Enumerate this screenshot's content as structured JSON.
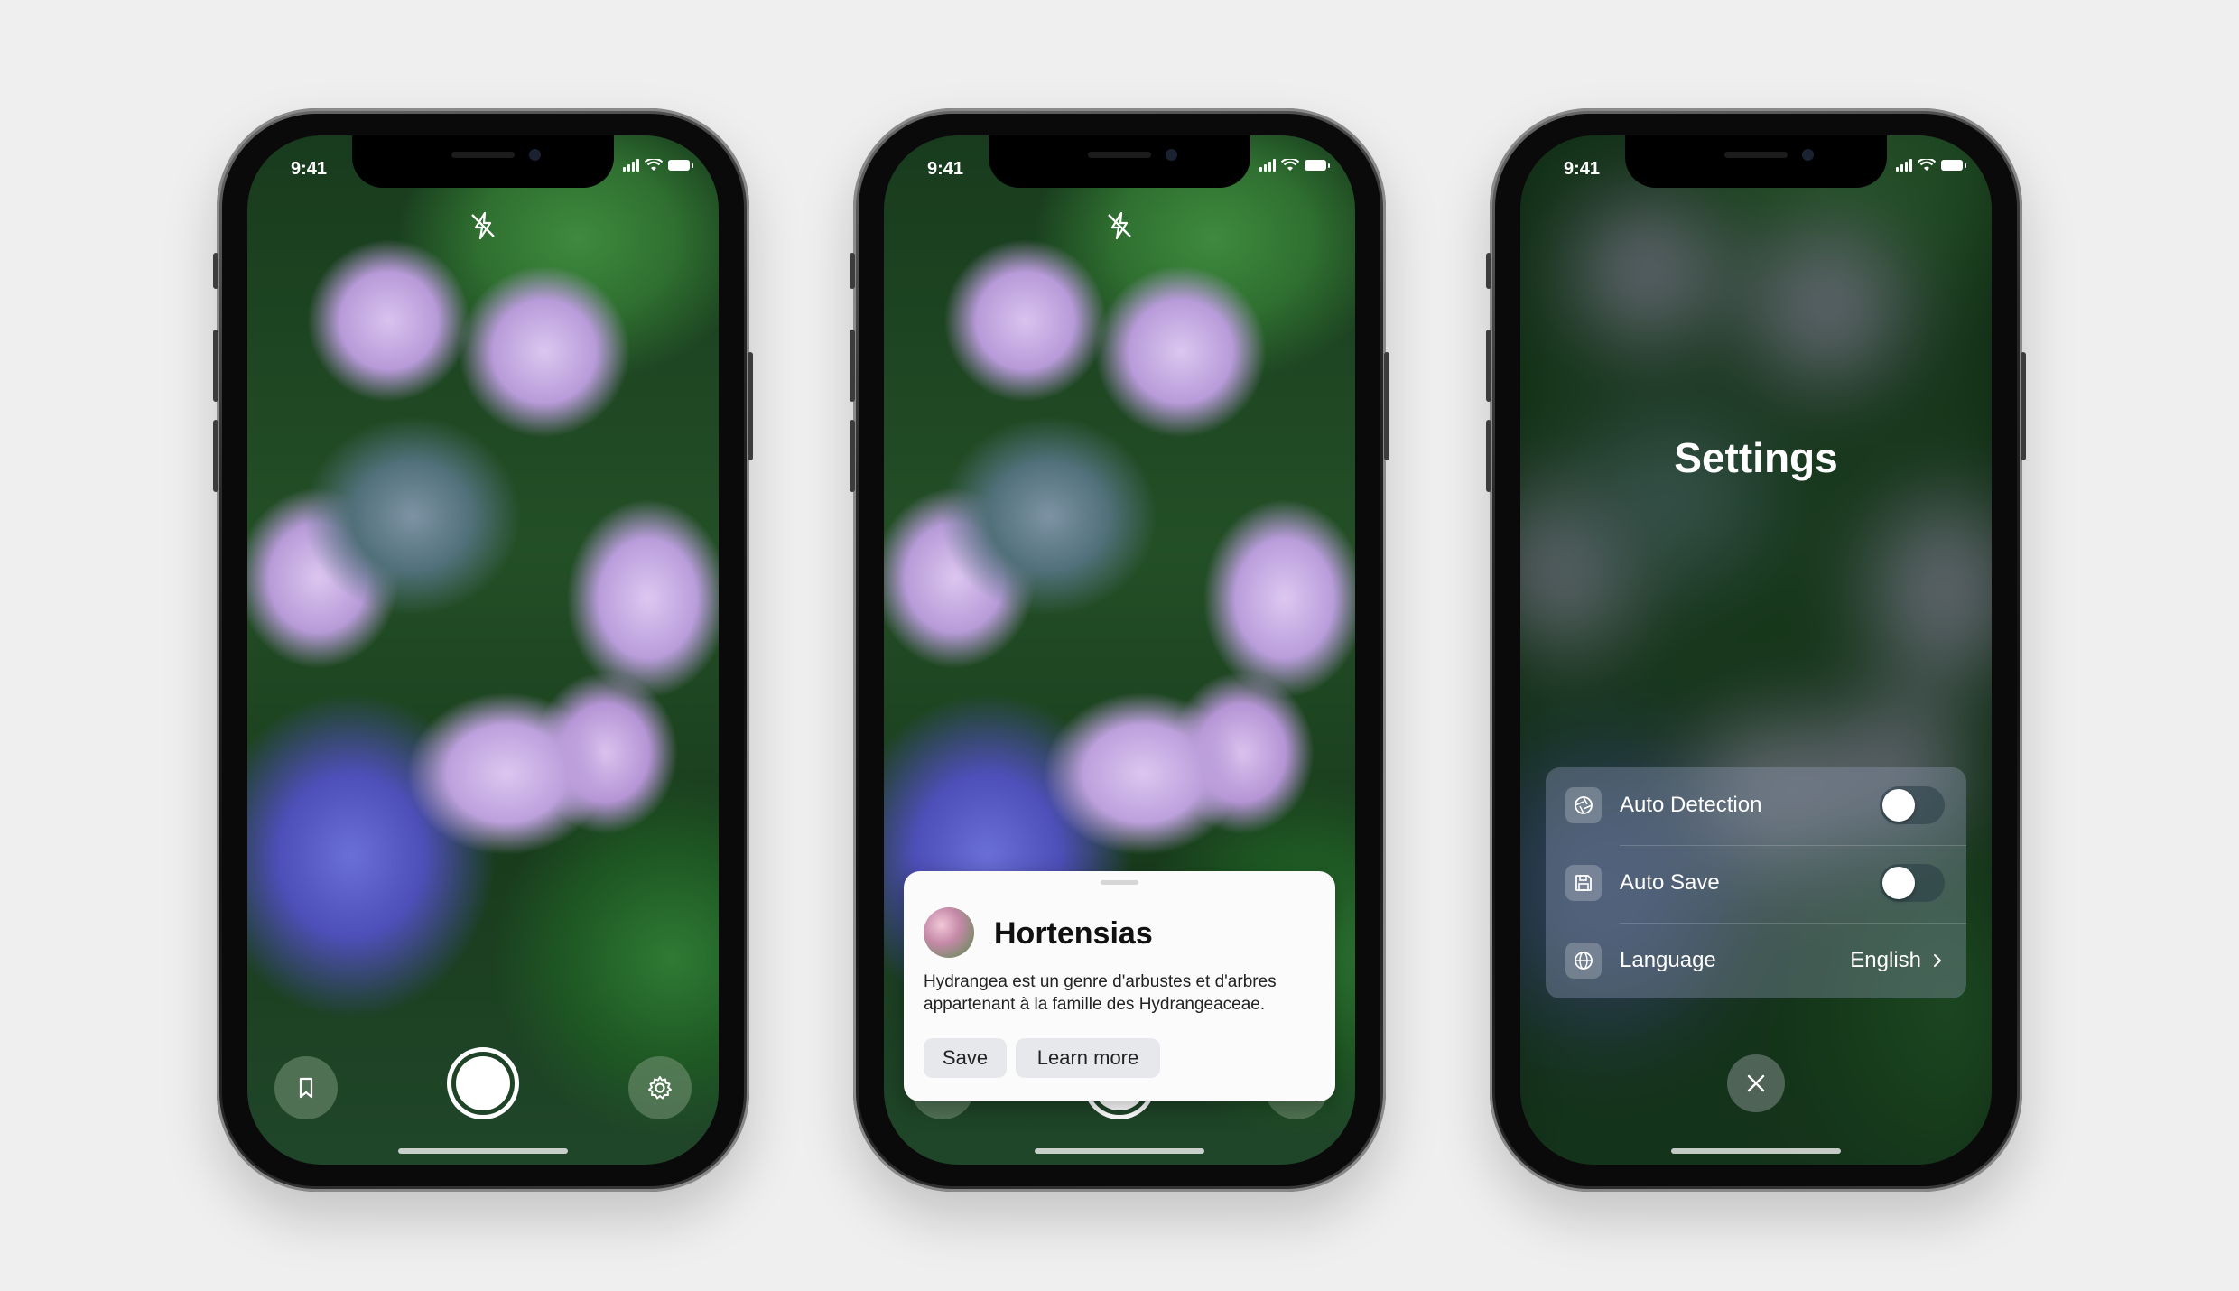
{
  "status_bar": {
    "time": "9:41"
  },
  "phone1": {
    "flash_icon": "flash-off-icon",
    "bookmark_icon": "bookmark-icon",
    "settings_icon": "gear-icon"
  },
  "phone2": {
    "card": {
      "title": "Hortensias",
      "description": "Hydrangea est un genre d'arbustes et d'arbres appartenant à la famille des Hydrangeaceae.",
      "save_label": "Save",
      "learn_more_label": "Learn more"
    }
  },
  "phone3": {
    "title": "Settings",
    "rows": [
      {
        "label": "Auto Detection",
        "icon": "aperture-icon",
        "toggle_on": false
      },
      {
        "label": "Auto Save",
        "icon": "floppy-disk-icon",
        "toggle_on": false
      },
      {
        "label": "Language",
        "icon": "globe-icon",
        "value": "English"
      }
    ],
    "close_icon": "close-icon"
  }
}
